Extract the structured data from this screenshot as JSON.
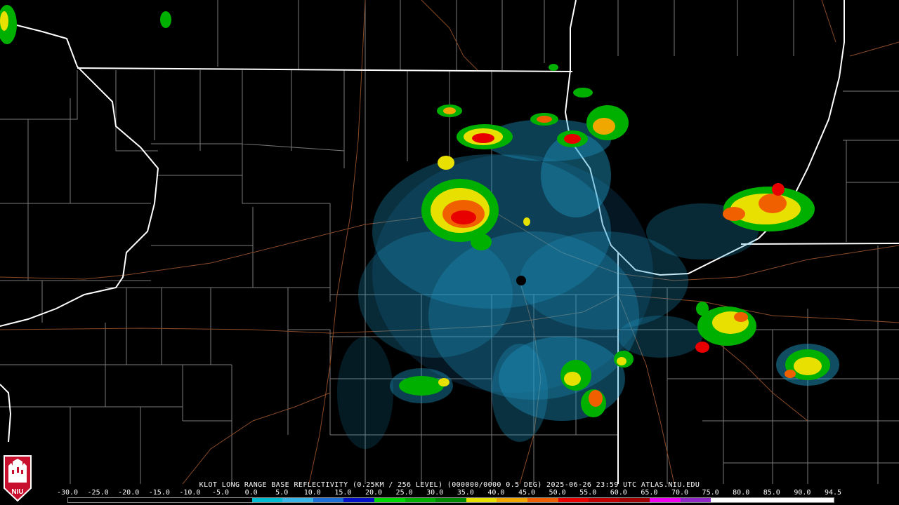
{
  "title": "KLOT LONG RANGE BASE REFLECTIVITY (0.25KM / 256 LEVEL) (000000/0000 0.5 DEG) 2025-06-26 23:59 UTC  ATLAS.NIU.EDU",
  "logo": {
    "text": "NIU",
    "icon": "niu-seal-icon"
  },
  "scale": {
    "labels": [
      "-30.0",
      "-25.0",
      "-20.0",
      "-15.0",
      "-10.0",
      "-5.0",
      "0.0",
      "5.0",
      "10.0",
      "15.0",
      "20.0",
      "25.0",
      "30.0",
      "35.0",
      "40.0",
      "45.0",
      "50.0",
      "55.0",
      "60.0",
      "65.0",
      "70.0",
      "75.0",
      "80.0",
      "85.0",
      "90.0",
      "94.5"
    ],
    "colors": [
      "#000000",
      "#000000",
      "#000000",
      "#000000",
      "#000000",
      "#000000",
      "#00bcd0",
      "#38b6e8",
      "#1d6fd8",
      "#0010c8",
      "#00d800",
      "#00b000",
      "#008800",
      "#e8e000",
      "#f0a800",
      "#f06000",
      "#e80000",
      "#c00000",
      "#a00000",
      "#f000f0",
      "#9028c8",
      "#ffffff",
      "#ffffff",
      "#ffffff",
      "#ffffff"
    ]
  },
  "colors": {
    "background": "#000000",
    "state_border": "#ffffff",
    "county_border": "#808080",
    "highway": "#8a4a28"
  }
}
